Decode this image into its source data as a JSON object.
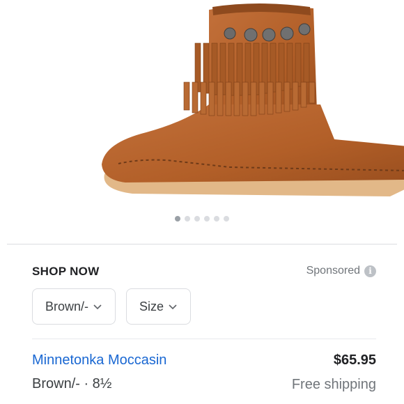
{
  "carousel": {
    "count": 6,
    "active_index": 0
  },
  "shop": {
    "heading": "SHOP NOW",
    "sponsored_label": "Sponsored",
    "info_icon": "i",
    "filters": [
      {
        "label": "Brown/-",
        "icon": "chevron-down-icon"
      },
      {
        "label": "Size",
        "icon": "chevron-down-icon"
      }
    ]
  },
  "product": {
    "title": "Minnetonka Moccasin",
    "price": "$65.95",
    "variant": "Brown/- · 8½",
    "shipping": "Free shipping"
  },
  "colors": {
    "link": "#1967d2",
    "suede": "#b5622a",
    "sole": "#e4b98a"
  }
}
